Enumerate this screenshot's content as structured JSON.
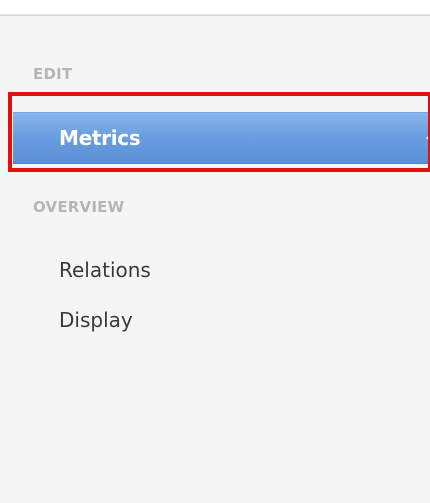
{
  "sidebar": {
    "sections": [
      {
        "header": "EDIT",
        "items": [
          {
            "label": "Metrics",
            "active": true
          }
        ]
      },
      {
        "header": "OVERVIEW",
        "items": [
          {
            "label": "Relations",
            "active": false
          },
          {
            "label": "Display",
            "active": false
          }
        ]
      }
    ]
  },
  "colors": {
    "active_item_bg": "#6b9fe0",
    "highlight_box": "#e01010",
    "section_header_text": "#b5b5b5",
    "sidebar_bg": "#f5f5f5"
  }
}
